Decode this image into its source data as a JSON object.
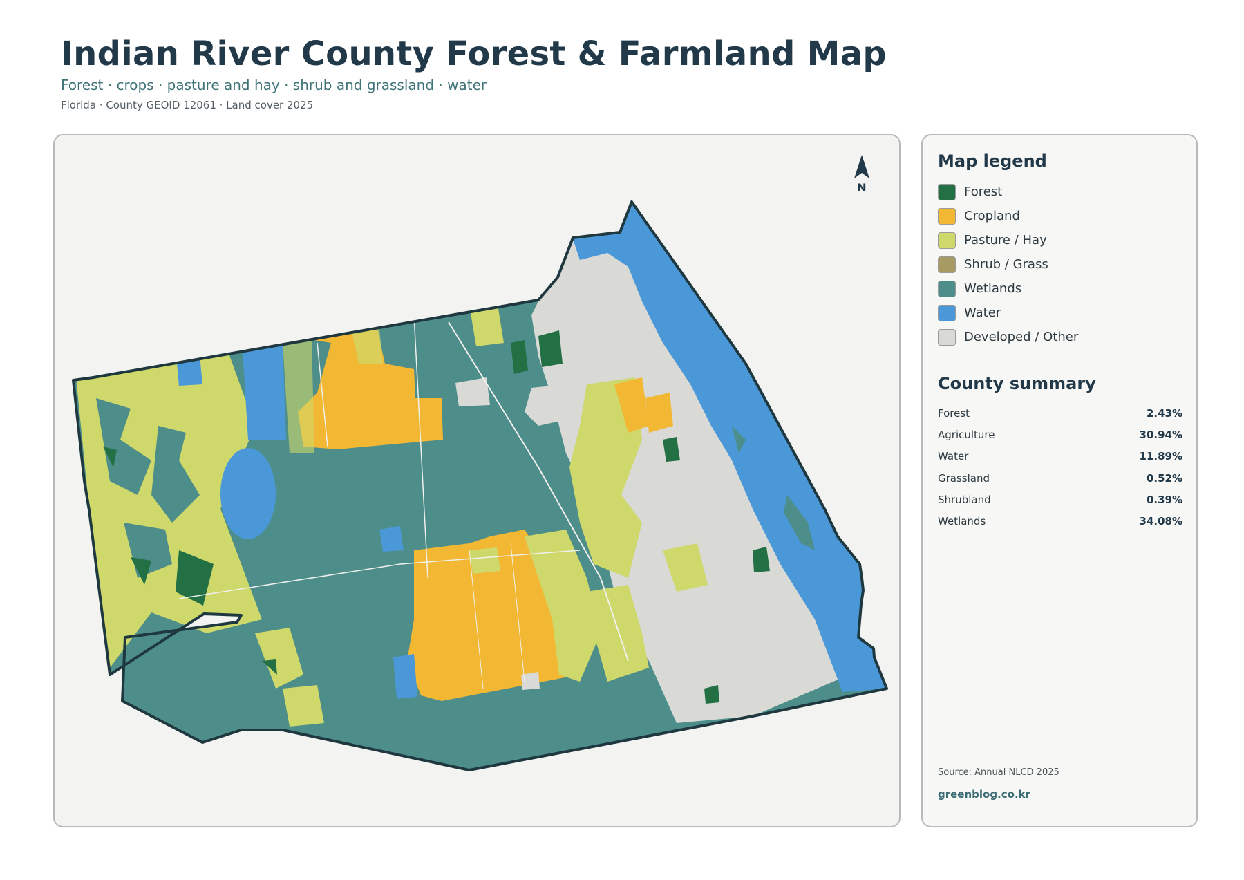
{
  "header": {
    "title": "Indian River County Forest & Farmland Map",
    "subtitle": "Forest · crops · pasture and hay · shrub and grassland · water",
    "meta": "Florida · County GEOID 12061 · Land cover 2025"
  },
  "map": {
    "north_label": "N",
    "north_icon": "north-arrow-icon",
    "colors": {
      "forest": "#237044",
      "cropland": "#f2b733",
      "pasture": "#cfd86a",
      "shrub": "#a79a63",
      "wetlands": "#4d8d8a",
      "water": "#4a98d8",
      "developed": "#d9d9d6",
      "boundary": "#1f3840"
    }
  },
  "legend": {
    "title": "Map legend",
    "items": [
      {
        "label": "Forest",
        "color": "#237044"
      },
      {
        "label": "Cropland",
        "color": "#f2b733"
      },
      {
        "label": "Pasture / Hay",
        "color": "#cfd86a"
      },
      {
        "label": "Shrub / Grass",
        "color": "#a79a63"
      },
      {
        "label": "Wetlands",
        "color": "#4d8d8a"
      },
      {
        "label": "Water",
        "color": "#4a98d8"
      },
      {
        "label": "Developed / Other",
        "color": "#d9d9d6"
      }
    ]
  },
  "summary": {
    "title": "County summary",
    "rows": [
      {
        "label": "Forest",
        "value": "2.43%"
      },
      {
        "label": "Agriculture",
        "value": "30.94%"
      },
      {
        "label": "Water",
        "value": "11.89%"
      },
      {
        "label": "Grassland",
        "value": "0.52%"
      },
      {
        "label": "Shrubland",
        "value": "0.39%"
      },
      {
        "label": "Wetlands",
        "value": "34.08%"
      }
    ]
  },
  "footer": {
    "source": "Source: Annual NLCD 2025",
    "site": "greenblog.co.kr"
  }
}
